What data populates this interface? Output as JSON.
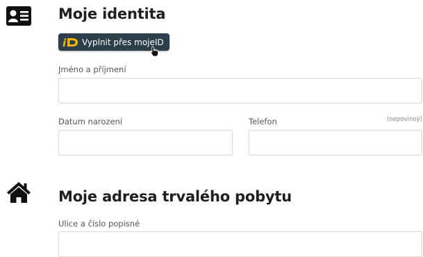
{
  "identity": {
    "title": "Moje identita",
    "icon": "id-card-icon",
    "mojeid_button": {
      "label": "Vyplnit přes mojeID",
      "logo": "mojeid-logo-icon"
    },
    "full_name": {
      "label": "Jméno a příjmení",
      "value": "",
      "placeholder": ""
    },
    "birth_date": {
      "label": "Datum narození",
      "value": "",
      "placeholder": ""
    },
    "phone": {
      "label": "Telefon",
      "optional": "(nepovinný)",
      "value": "",
      "placeholder": ""
    }
  },
  "address": {
    "title": "Moje adresa trvalého pobytu",
    "icon": "home-icon",
    "street": {
      "label": "Ulice a číslo popisné",
      "value": "",
      "placeholder": ""
    }
  },
  "colors": {
    "button_bg": "#2b3e4a",
    "logo_accent": "#f2b705",
    "icon_color": "#111111"
  }
}
